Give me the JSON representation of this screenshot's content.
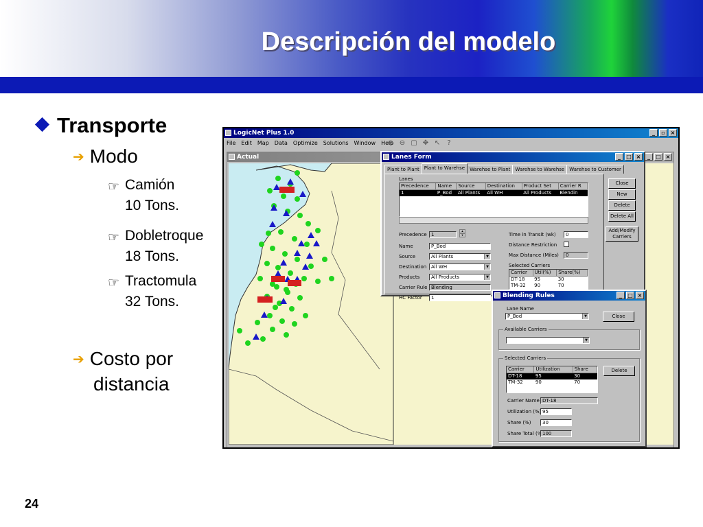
{
  "slide": {
    "title": "Descripción del modelo",
    "page_number": "24"
  },
  "bullets": {
    "level1": "Transporte",
    "modo": "Modo",
    "camion": "Camión",
    "camion_cap": "10 Tons.",
    "dobletroque": "Dobletroque",
    "dobletroque_cap": "18 Tons.",
    "tractomula": "Tractomula",
    "tractomula_cap": "32 Tons.",
    "costo_1": "Costo por",
    "costo_2": "distancia"
  },
  "app": {
    "title": "LogicNet Plus 1.0",
    "menu": [
      "File",
      "Edit",
      "Map",
      "Data",
      "Optimize",
      "Solutions",
      "Window",
      "Help"
    ],
    "map_window_title": "Actual"
  },
  "lanes_form": {
    "title": "Lanes Form",
    "tabs": [
      "Plant to Plant",
      "Plant to Warehse",
      "Warehse to Plant",
      "Warehse to Warehse",
      "Warehse to Customer"
    ],
    "lanes_group": "Lanes",
    "columns": [
      "Precedence",
      "Name",
      "Source",
      "Destination",
      "Product Set",
      "Carrier R"
    ],
    "rows": [
      [
        "1",
        "P_Bod",
        "All Plants",
        "All WH",
        "All Products",
        "Blendin"
      ]
    ],
    "labels": {
      "precedence": "Precedence",
      "name": "Name",
      "source": "Source",
      "destination": "Destination",
      "products": "Products",
      "carrier_rule": "Carrier Rule",
      "hc_factor": "HC Factor",
      "transit": "Time in Transit (wk)",
      "dist_restr": "Distance Restriction",
      "max_dist": "Max Distance (Miles)",
      "selected_carriers": "Selected Carriers"
    },
    "values": {
      "precedence": "1",
      "name": "P_Bod",
      "source": "All Plants",
      "destination": "All WH",
      "products": "All Products",
      "carrier_rule": "Blending",
      "hc_factor": "1",
      "transit": "0",
      "max_dist": "0"
    },
    "carrier_cols": [
      "Carrier",
      "Util(%)",
      "Share(%)"
    ],
    "carrier_rows": [
      [
        "DT-18",
        "95",
        "30"
      ],
      [
        "TM-32",
        "90",
        "70"
      ]
    ],
    "buttons": [
      "Close",
      "New",
      "Delete",
      "Delete All",
      "Add/Modify Carriers"
    ]
  },
  "blending": {
    "title": "Blending Rules",
    "lane_name_label": "Lane Name",
    "lane_name": "P_Bod",
    "available_label": "Available Carriers",
    "selected_label": "Selected Carriers",
    "columns": [
      "Carrier",
      "Utilization",
      "Share"
    ],
    "rows": [
      [
        "DT-18",
        "95",
        "30"
      ],
      [
        "TM-32",
        "90",
        "70"
      ]
    ],
    "carrier_name_label": "Carrier Name",
    "carrier_name": "DT-18",
    "util_label": "Utilization (%)",
    "util": "95",
    "share_label": "Share (%)",
    "share": "30",
    "share_total_label": "Share Total (%)",
    "share_total": "100",
    "close": "Close",
    "delete": "Delete"
  },
  "colors": {
    "accent_blue": "#0c1ab5",
    "plant_marker": "#d42020",
    "warehouse_marker": "#1a1ac8",
    "customer_marker": "#19d419",
    "map_land": "#f6f4cc"
  }
}
